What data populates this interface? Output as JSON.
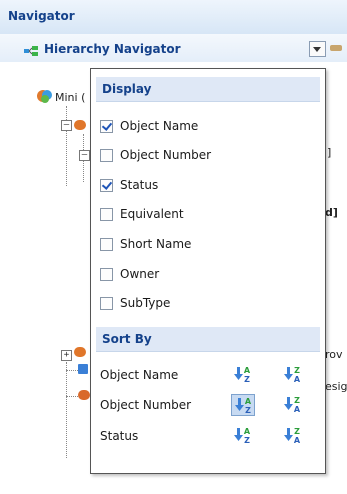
{
  "panel": {
    "title": "Navigator"
  },
  "navigator": {
    "title": "Hierarchy Navigator",
    "dropdown_icon": "chevron-down-icon"
  },
  "tree_peek": {
    "root_fragment": "Mini (",
    "bracket_1": "]",
    "bracket_2": "d]",
    "fragment_rov": "rov",
    "fragment_esig": "esig"
  },
  "menu": {
    "display_header": "Display",
    "display_items": [
      {
        "label": "Object Name",
        "checked": true
      },
      {
        "label": "Object Number",
        "checked": false
      },
      {
        "label": "Status",
        "checked": true
      },
      {
        "label": "Equivalent",
        "checked": false
      },
      {
        "label": "Short Name",
        "checked": false
      },
      {
        "label": "Owner",
        "checked": false
      },
      {
        "label": "SubType",
        "checked": false
      }
    ],
    "sort_header": "Sort By",
    "sort_items": [
      {
        "label": "Object Name",
        "active": "none"
      },
      {
        "label": "Object Number",
        "active": "ascending"
      },
      {
        "label": "Status",
        "active": "none"
      }
    ],
    "sort_icons": [
      "sort-ascending-icon",
      "sort-descending-icon"
    ]
  },
  "colors": {
    "header_text": "#15428b",
    "section_bg": "#dfe8f6",
    "accent_blue": "#3a7fd6"
  }
}
